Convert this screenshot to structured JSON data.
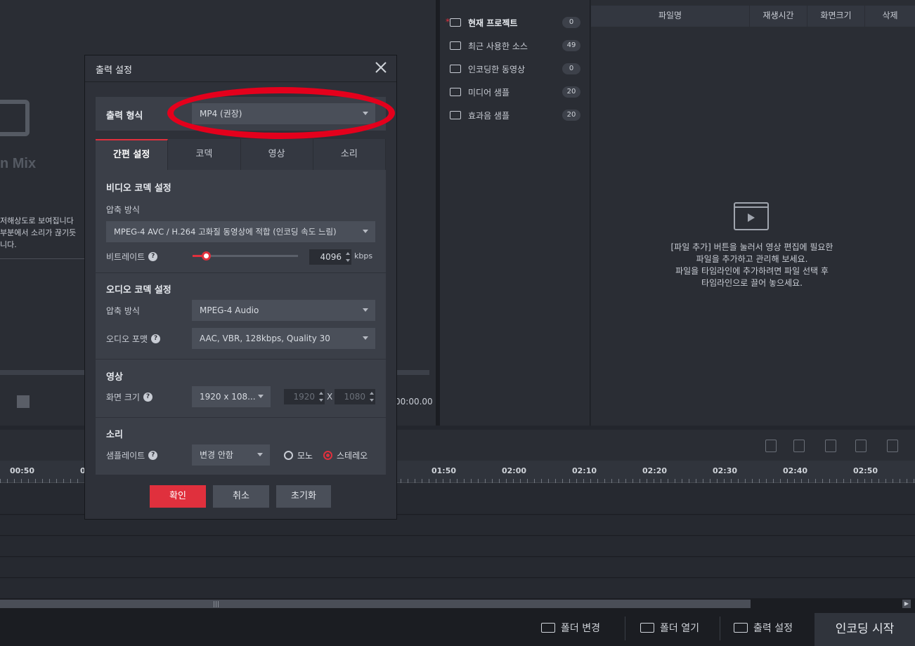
{
  "background": {
    "logo_text": "n Mix",
    "notice_lines": [
      "저해상도로 보여집니다",
      "부분에서 소리가 끊기듯",
      "니다."
    ],
    "time_readout": "00:00.00"
  },
  "library": {
    "items": [
      {
        "label": "현재 프로젝트",
        "count": "0",
        "active": true
      },
      {
        "label": "최근 사용한 소스",
        "count": "49"
      },
      {
        "label": "인코딩한 동영상",
        "count": "0"
      },
      {
        "label": "미디어 샘플",
        "count": "20"
      },
      {
        "label": "효과음 샘플",
        "count": "20"
      }
    ]
  },
  "file_list": {
    "columns": [
      "파일명",
      "재생시간",
      "화면크기",
      "삭제"
    ],
    "empty_message": [
      "[파일 추가] 버튼을 눌러서 영상 편집에 필요한",
      "파일을 추가하고 관리해 보세요.",
      "파일을 타임라인에 추가하려면 파일 선택 후",
      "타임라인으로 끌어 놓으세요."
    ]
  },
  "timeline": {
    "ticks": [
      "00:50",
      "0",
      "01:50",
      "02:00",
      "02:10",
      "02:20",
      "02:30",
      "02:40",
      "02:50"
    ]
  },
  "bottom_bar": {
    "change_folder": "폴더 변경",
    "open_folder": "폴더 열기",
    "output_settings": "출력 설정",
    "start_encoding": "인코딩 시작"
  },
  "dialog": {
    "title": "출력 설정",
    "format_label": "출력 형식",
    "format_value": "MP4 (권장)",
    "tabs": [
      "간편 설정",
      "코덱",
      "영상",
      "소리"
    ],
    "video_codec": {
      "title": "비디오 코덱 설정",
      "compression_label": "압축 방식",
      "compression_value": "MPEG-4 AVC / H.264 고화질 동영상에 적합 (인코딩 속도 느림)",
      "bitrate_label": "비트레이트",
      "bitrate_value": "4096",
      "bitrate_unit": "kbps"
    },
    "audio_codec": {
      "title": "오디오 코덱 설정",
      "compression_label": "압축 방식",
      "compression_value": "MPEG-4 Audio",
      "format_label": "오디오 포맷",
      "format_value": "AAC, VBR, 128kbps, Quality 30"
    },
    "video": {
      "title": "영상",
      "size_label": "화면 크기",
      "size_value": "1920 x 108...",
      "width": "1920",
      "height": "1080",
      "x": "X"
    },
    "sound": {
      "title": "소리",
      "samplerate_label": "샘플레이트",
      "samplerate_value": "변경 안함",
      "mono": "모노",
      "stereo": "스테레오"
    },
    "buttons": {
      "ok": "확인",
      "cancel": "취소",
      "reset": "초기화"
    }
  },
  "colors": {
    "accent": "#e0303d",
    "highlight": "#e4001c"
  }
}
